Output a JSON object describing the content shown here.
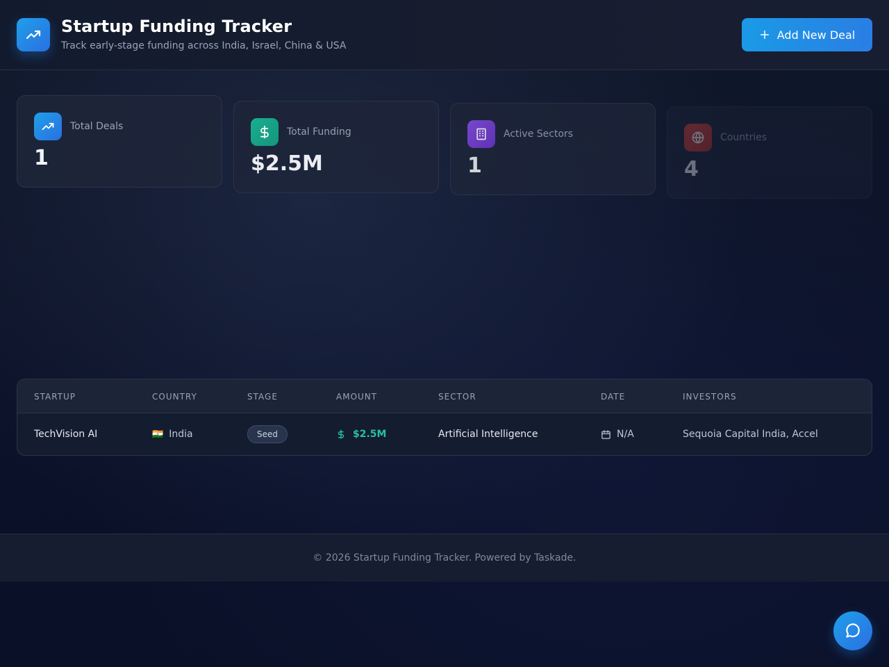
{
  "header": {
    "title": "Startup Funding Tracker",
    "subtitle": "Track early-stage funding across India, Israel, China & USA",
    "add_button_label": "Add New Deal"
  },
  "stats": [
    {
      "label": "Total Deals",
      "value": "1",
      "icon": "trending-up-icon",
      "color": "#2196f3"
    },
    {
      "label": "Total Funding",
      "value": "$2.5M",
      "icon": "dollar-icon",
      "color": "#17a589"
    },
    {
      "label": "Active Sectors",
      "value": "1",
      "icon": "building-icon",
      "color": "#7b45d6"
    },
    {
      "label": "Countries",
      "value": "4",
      "icon": "globe-icon",
      "color": "#c0392b"
    }
  ],
  "table": {
    "headers": [
      "STARTUP",
      "COUNTRY",
      "STAGE",
      "AMOUNT",
      "SECTOR",
      "DATE",
      "INVESTORS"
    ],
    "rows": [
      {
        "startup": "TechVision AI",
        "country_flag": "🇮🇳",
        "country": "India",
        "stage": "Seed",
        "amount": "$2.5M",
        "sector": "Artificial Intelligence",
        "date": "N/A",
        "investors": "Sequoia Capital India, Accel"
      }
    ]
  },
  "footer": {
    "text": "© 2026 Startup Funding Tracker. Powered by Taskade."
  },
  "colors": {
    "accent": "#1a9ae6",
    "amount_green": "#22c2a0"
  }
}
